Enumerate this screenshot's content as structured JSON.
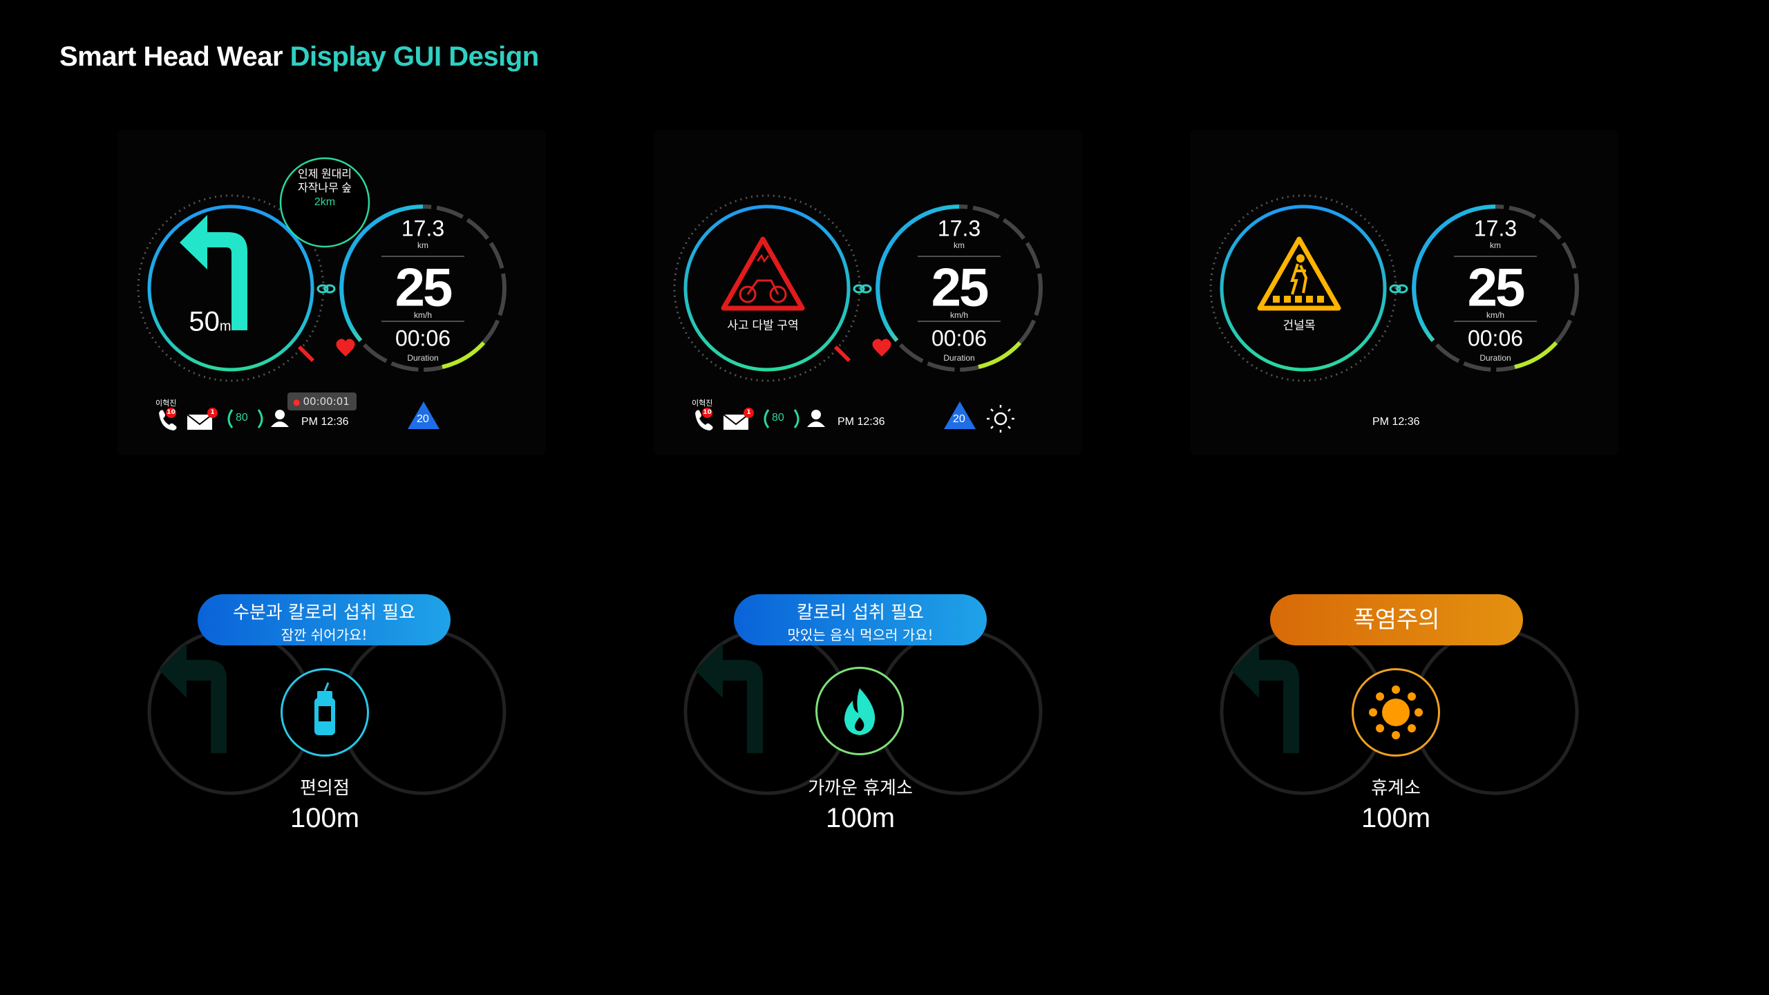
{
  "header": {
    "title_part1": "Smart Head Wear",
    "title_part2": "Display GUI Design"
  },
  "colors": {
    "accent_teal": "#2fd0c2",
    "ring_blue": "#1ea3f0",
    "ring_green": "#2ad7a0",
    "alert_red": "#e21b1b",
    "warn_yellow": "#ffb400",
    "orange": "#e47d0c"
  },
  "dash": {
    "distance_value": "17.3",
    "distance_unit": "km",
    "speed_value": "25",
    "speed_unit": "km/h",
    "duration_value": "00:06",
    "duration_label": "Duration"
  },
  "panel1": {
    "turn_distance": "50",
    "turn_unit": "m",
    "poi_line1": "인제 원대리",
    "poi_line2": "자작나무 숲",
    "poi_distance": "2km",
    "user": "이혁진",
    "call_count": "10",
    "mail_count": "1",
    "score": "80",
    "time": "PM 12:36",
    "recording": "00:00:01",
    "altitude": "20",
    "icons": [
      "arrow-turn-left-icon",
      "phone-icon",
      "mail-icon",
      "laurel-icon",
      "user-icon",
      "pen-icon",
      "heart-icon"
    ]
  },
  "panel2": {
    "warning": "사고 다발 구역",
    "user": "이혁진",
    "call_count": "10",
    "mail_count": "1",
    "score": "80",
    "time": "PM 12:36",
    "altitude": "20",
    "icons": [
      "bicycle-warning-icon",
      "sun-icon"
    ]
  },
  "panel3": {
    "warning": "건널목",
    "time": "PM 12:36",
    "icons": [
      "crosswalk-warning-icon"
    ]
  },
  "cards": [
    {
      "line1": "수분과 칼로리 섭취 필요",
      "line2": "잠깐 쉬어가요!",
      "poi": "편의점",
      "distance": "100m",
      "icon": "drink-bottle-icon"
    },
    {
      "line1": "칼로리 섭취 필요",
      "line2": "맛있는 음식 먹으러 가요!",
      "poi": "가까운 휴계소",
      "distance": "100m",
      "icon": "flame-icon"
    },
    {
      "line1": "폭염주의",
      "poi": "휴계소",
      "distance": "100m",
      "icon": "sun-hot-icon"
    }
  ]
}
